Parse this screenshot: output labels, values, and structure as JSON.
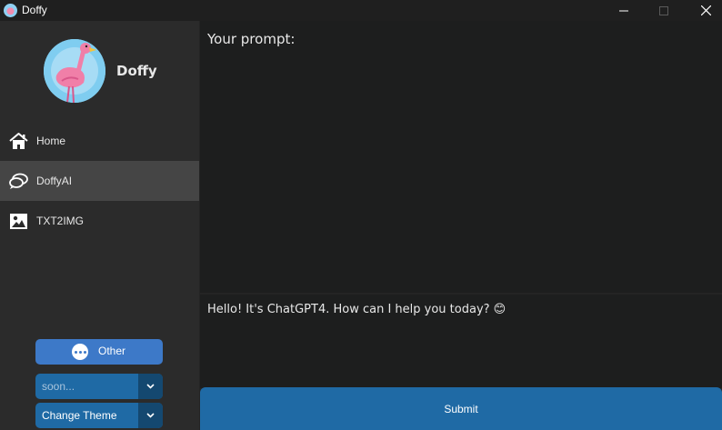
{
  "window": {
    "title": "Doffy",
    "icon": "flamingo-icon",
    "controls": [
      "minimize-icon",
      "maximize-icon",
      "close-icon"
    ]
  },
  "sidebar": {
    "brand": "Doffy",
    "logo": "flamingo-logo",
    "items": [
      {
        "label": "Home",
        "icon": "home-icon",
        "active": false
      },
      {
        "label": "DoffyAI",
        "icon": "chat-bubbles-icon",
        "active": true
      },
      {
        "label": "TXT2IMG",
        "icon": "image-icon",
        "active": false
      }
    ],
    "other_button": {
      "label": "Other",
      "icon": "more-icon"
    },
    "model_select": {
      "value": "soon..."
    },
    "theme_select": {
      "value": "Change Theme"
    }
  },
  "main": {
    "prompt_label": "Your prompt:",
    "response": "Hello! It's ChatGPT4. How can I help you today? 😊",
    "submit_label": "Submit"
  },
  "colors": {
    "accent": "#1f6aa5",
    "accent_dark": "#144870",
    "other_button": "#3d79c8",
    "sidebar_bg": "#2b2b2b",
    "active_item": "#454545",
    "textbox_bg": "#1d1e1e"
  }
}
